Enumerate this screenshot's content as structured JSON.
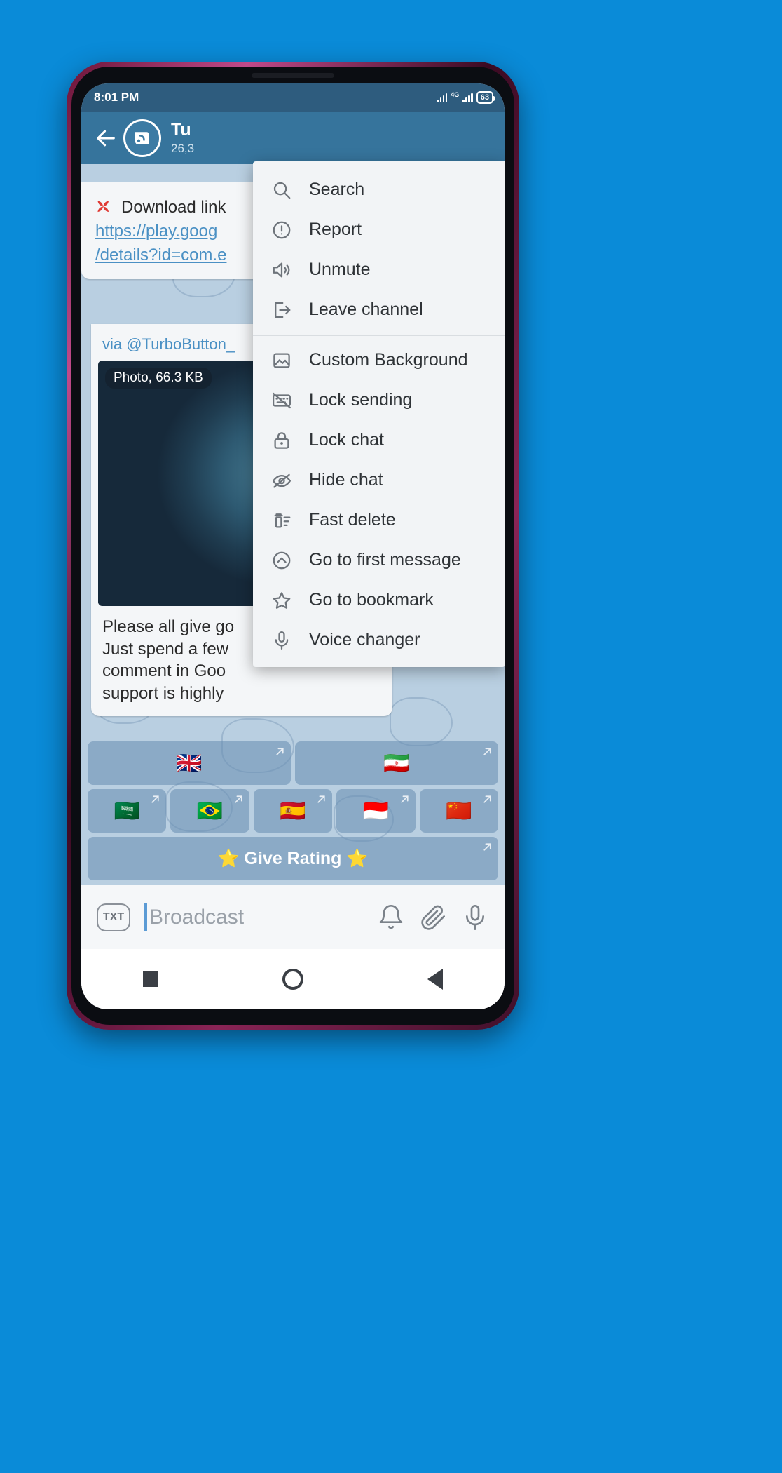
{
  "status_bar": {
    "time": "8:01 PM",
    "network_label": "4G",
    "battery_level": "63"
  },
  "app_bar": {
    "back_icon": "arrow-left-icon",
    "avatar_icon": "channel-avatar-icon",
    "title": "Tu",
    "subtitle": "26,3"
  },
  "chat": {
    "link_message": {
      "emoji": "red-burst-emoji",
      "text": "Download link",
      "url_line_1": "https://play.goog",
      "url_line_2": "/details?id=com.e"
    },
    "photo_message": {
      "via": "via @TurboButton_",
      "photo_size_badge": "Photo, 66.3 KB",
      "caption_lines": [
        "Please all give go",
        "Just spend a few",
        "comment in Goo",
        "support is highly"
      ]
    },
    "inline_keyboard": {
      "rows": [
        [
          {
            "label": "🇬🇧",
            "external_icon": "external-link-icon"
          },
          {
            "label": "🇮🇷",
            "external_icon": "external-link-icon"
          }
        ],
        [
          {
            "label": "🇸🇦",
            "external_icon": "external-link-icon"
          },
          {
            "label": "🇧🇷",
            "external_icon": "external-link-icon"
          },
          {
            "label": "🇪🇸",
            "external_icon": "external-link-icon"
          },
          {
            "label": "🇮🇩",
            "external_icon": "external-link-icon"
          },
          {
            "label": "🇨🇳",
            "external_icon": "external-link-icon"
          }
        ],
        [
          {
            "label": "⭐ Give Rating ⭐",
            "external_icon": "external-link-icon"
          }
        ]
      ]
    }
  },
  "input_bar": {
    "txt_badge": "TXT",
    "placeholder": "Broadcast",
    "value": "",
    "icons": [
      "bell-icon",
      "paperclip-icon",
      "microphone-icon"
    ]
  },
  "nav_bar": {
    "items": [
      "recents-square-icon",
      "home-circle-icon",
      "back-triangle-icon"
    ]
  },
  "popup_menu": {
    "groups": [
      {
        "items": [
          {
            "label": "Search",
            "icon": "search-icon"
          },
          {
            "label": "Report",
            "icon": "exclamation-circle-icon"
          },
          {
            "label": "Unmute",
            "icon": "speaker-on-icon"
          },
          {
            "label": "Leave channel",
            "icon": "exit-icon"
          }
        ]
      },
      {
        "items": [
          {
            "label": "Custom Background",
            "icon": "image-icon"
          },
          {
            "label": "Lock sending",
            "icon": "keyboard-off-icon"
          },
          {
            "label": "Lock chat",
            "icon": "lock-icon"
          },
          {
            "label": "Hide chat",
            "icon": "eye-off-icon"
          },
          {
            "label": "Fast delete",
            "icon": "trash-list-icon"
          },
          {
            "label": "Go to first message",
            "icon": "chevron-up-circle-icon"
          },
          {
            "label": "Go to bookmark",
            "icon": "star-icon"
          },
          {
            "label": "Voice changer",
            "icon": "microphone-icon"
          }
        ]
      }
    ]
  },
  "colors": {
    "background": "#0A8BD8",
    "app_bar": "#36749C",
    "status_bar": "#2E5C7E",
    "chat_background": "#B9CFE1",
    "link_blue": "#4A90C4",
    "menu_background": "#F2F4F6"
  }
}
